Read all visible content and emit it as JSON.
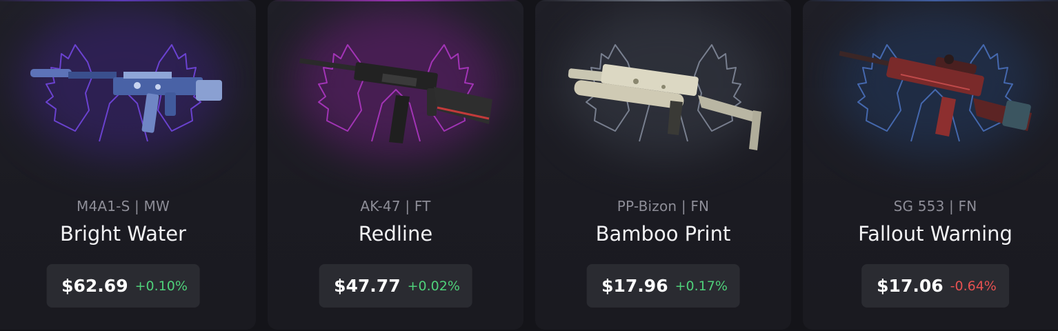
{
  "cards": [
    {
      "weapon_icon": "m4a1s-bright-water-icon",
      "emblem_icon": "phoenix-emblem-icon",
      "rarity_color": "#7a4bf0",
      "meta": "M4A1-S | MW",
      "name": "Bright Water",
      "price": "$62.69",
      "change": "+0.10%",
      "change_direction": "up"
    },
    {
      "weapon_icon": "ak47-redline-icon",
      "emblem_icon": "phoenix-emblem-icon",
      "rarity_color": "#c23cd8",
      "meta": "AK-47 | FT",
      "name": "Redline",
      "price": "$47.77",
      "change": "+0.02%",
      "change_direction": "up"
    },
    {
      "weapon_icon": "ppbizon-bamboo-print-icon",
      "emblem_icon": "phoenix-emblem-icon",
      "rarity_color": "#9aa3b5",
      "meta": "PP-Bizon | FN",
      "name": "Bamboo Print",
      "price": "$17.96",
      "change": "+0.17%",
      "change_direction": "up"
    },
    {
      "weapon_icon": "sg553-fallout-warning-icon",
      "emblem_icon": "phoenix-emblem-icon",
      "rarity_color": "#4f78c9",
      "meta": "SG 553 | FN",
      "name": "Fallout Warning",
      "price": "$17.06",
      "change": "-0.64%",
      "change_direction": "down"
    }
  ],
  "colors": {
    "positive": "#4fd17a",
    "negative": "#e65151",
    "card_bg": "#1d1d24",
    "price_box_bg": "#2a2b31"
  }
}
